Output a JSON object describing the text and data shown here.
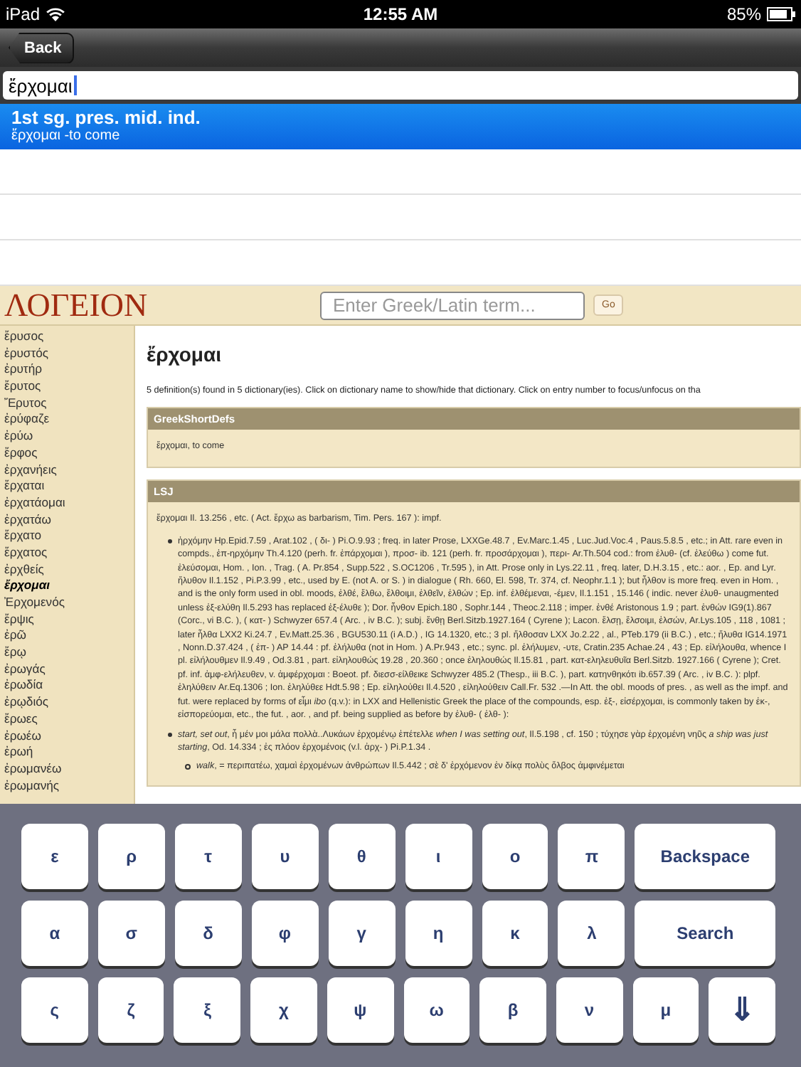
{
  "status_bar": {
    "device": "iPad",
    "time": "12:55 AM",
    "battery": "85%"
  },
  "nav_bar": {
    "back": "Back"
  },
  "search": {
    "value": "ἔρχομαι"
  },
  "results": [
    {
      "title": "1st sg. pres. mid. ind.",
      "subtitle": "ἔρχομαι  -to come",
      "selected": true
    }
  ],
  "logeion": {
    "logo": "ΛΟΓΕΙΟΝ",
    "search": {
      "placeholder": "Enter Greek/Latin term..."
    },
    "go": "Go",
    "word_list": [
      {
        "label": "ἔρυσος",
        "selected": false
      },
      {
        "label": "ἐρυστός",
        "selected": false
      },
      {
        "label": "ἐρυτήρ",
        "selected": false
      },
      {
        "label": "ἔρυτος",
        "selected": false
      },
      {
        "label": "Ἔρυτος",
        "selected": false
      },
      {
        "label": "ἐρύφαζε",
        "selected": false
      },
      {
        "label": "ἐρύω",
        "selected": false
      },
      {
        "label": "ἔρφος",
        "selected": false
      },
      {
        "label": "ἐρχανήεις",
        "selected": false
      },
      {
        "label": "ἔρχαται",
        "selected": false
      },
      {
        "label": "ἐρχατάομαι",
        "selected": false
      },
      {
        "label": "ἐρχατάω",
        "selected": false
      },
      {
        "label": "ἔρχατο",
        "selected": false
      },
      {
        "label": "ἔρχατος",
        "selected": false
      },
      {
        "label": "ἐρχθείς",
        "selected": false
      },
      {
        "label": "ἔρχομαι",
        "selected": true
      },
      {
        "label": "Ἐρχομενός",
        "selected": false
      },
      {
        "label": "ἔρψις",
        "selected": false
      },
      {
        "label": "ἐρῶ",
        "selected": false
      },
      {
        "label": "ἔρῳ",
        "selected": false
      },
      {
        "label": "ἐρωγάς",
        "selected": false
      },
      {
        "label": "ἐρωδία",
        "selected": false
      },
      {
        "label": "ἐρῳδιός",
        "selected": false
      },
      {
        "label": "ἔρωες",
        "selected": false
      },
      {
        "label": "ἐρωέω",
        "selected": false
      },
      {
        "label": "ἐρωή",
        "selected": false
      },
      {
        "label": "ἐρωμανέω",
        "selected": false
      },
      {
        "label": "ἐρωμανής",
        "selected": false
      }
    ],
    "headword": "ἔρχομαι",
    "summary": "5 definition(s) found in 5 dictionary(ies). Click on dictionary name to show/hide that dictionary. Click on entry number to focus/unfocus on tha",
    "dictionaries": [
      {
        "name": "GreekShortDefs",
        "blocks": [
          {
            "kind": "para",
            "text": "ἔρχομαι, to come"
          }
        ]
      },
      {
        "name": "LSJ",
        "blocks": [
          {
            "kind": "para",
            "text": "ἔρχομαι Il. 13.256 , etc. ( Act. ἔρχω as barbarism, Tim. Pers. 167 ): impf."
          },
          {
            "kind": "bullet",
            "text": "ἠρχόμην Hp.Epid.7.59 , Arat.102 , ( δι- ) Pi.O.9.93 ; freq. in later Prose, LXXGe.48.7 , Ev.Marc.1.45 , Luc.Jud.Voc.4 , Paus.5.8.5 , etc.; in Att. rare even in compds., ἐπ-ηρχόμην Th.4.120 (perh. fr. ἐπάρχομαι ), προσ- ib. 121 (perh. fr. προσάρχομαι ), περι- Ar.Th.504 cod.: from ἐλυθ- (cf. ἐλεύθω ) come fut. ἐλεύσομαι, Hom. , Ion. , Trag. ( A. Pr.854 , Supp.522 , S.OC1206 , Tr.595 ), in Att. Prose only in Lys.22.11 , freq. later, D.H.3.15 , etc.: aor. , Ep. and Lyr. ἤλυθον Il.1.152 , Pi.P.3.99 , etc., used by E. (not A. or S. ) in dialogue ( Rh. 660, El. 598, Tr. 374, cf. Neophr.1.1 ); but ἦλθον is more freq. even in Hom. , and is the only form used in obl. moods, ἐλθέ, ἔλθω, ἔλθοιμι, ἐλθεῖν, ἐλθών ; Ep. inf. ἐλθέμεναι, -έμεν, Il.1.151 , 15.146 ( indic. never ἐλυθ- unaugmented unless ἐξ-ελύθη Il.5.293 has replaced ἐξ-έλυθε ); Dor. ἦνθον Epich.180 , Sophr.144 , Theoc.2.118 ; imper. ἐνθέ Aristonous 1.9 ; part. ἐνθών IG9(1).867 (Corc., vi B.C. ), ( κατ- ) Schwyzer 657.4 ( Arc. , iv B.C. ); subj. ἔνθῃ Berl.Sitzb.1927.164 ( Cyrene ); Lacon. ἔλσῃ, ἔλσοιμι, ἐλσών, Ar.Lys.105 , 118 , 1081 ; later ἦλθα LXX2 Ki.24.7 , Ev.Matt.25.36 , BGU530.11 (i A.D.) , IG 14.1320, etc.; 3 pl. ἤλθοσαν LXX Jo.2.22 , al., PTeb.179 (ii B.C.) , etc.; ἤλυθα IG14.1971 , Nonn.D.37.424 , ( ἐπ- ) AP 14.44 : pf. ἐλήλυθα (not in Hom. ) A.Pr.943 , etc.; sync. pl. ἐλήλυμεν, -υτε, Cratin.235 Achae.24 , 43 ; Ep. εἰλήλουθα, whence I pl. εἰλήλουθμεν Il.9.49 , Od.3.81 , part. εἰληλουθώς 19.28 , 20.360 ; once ἐληλουθώς Il.15.81 , part. κατ-εληλευθυῖα Berl.Sitzb. 1927.166 ( Cyrene ); Cret. pf. inf. ἀμφ-ελήλευθεν, v. ἀμφέρχομαι : Boeot. pf. διεσσ-είλθεικε Schwyzer 485.2 (Thesp., iii B.C. ), part. κατηνθηκότι ib.657.39 ( Arc. , iv B.C. ): plpf. ἐληλύθειν Ar.Eq.1306 ; Ion. ἐληλύθεε Hdt.5.98 ; Ep. εἰληλούθει Il.4.520 , εἰληλούθειν Call.Fr. 532 .—In Att. the obl. moods of pres. , as well as the impf. and fut. were replaced by forms of εἶμι *ibo* (q.v.): in LXX and Hellenistic Greek the place of the compounds, esp. ἐξ-, εἰσέρχομαι, is commonly taken by ἐκ-, εἰσπορεύομαι, etc., the fut. , aor. , and pf. being supplied as before by ἐλυθ- ( ἐλθ- ):"
          },
          {
            "kind": "bullet",
            "text": "*start, set out*, ἦ μέν μοι μάλα πολλὰ..Λυκάων ἐρχομένῳ ἐπέτελλε *when I was setting out*, Il.5.198 , cf. 150 ; τύχησε γὰρ ἐρχομένη νηῦς *a ship was just starting*, Od. 14.334 ; ἐς πλόον ἐρχομένοις (v.l. ἀρχ- ) Pi.P.1.34 ."
          },
          {
            "kind": "subbullet",
            "text": "*walk*, = περιπατέω, χαμαὶ ἐρχομένων ἀνθρώπων Il.5.442 ; σὲ δ' ἐρχόμενον ἐν δίκᾳ πολὺς ὄλβος ἀμφινέμεται"
          }
        ]
      }
    ]
  },
  "keyboard": [
    [
      {
        "label": "ε",
        "kind": "letter"
      },
      {
        "label": "ρ",
        "kind": "letter"
      },
      {
        "label": "τ",
        "kind": "letter"
      },
      {
        "label": "υ",
        "kind": "letter"
      },
      {
        "label": "θ",
        "kind": "letter"
      },
      {
        "label": "ι",
        "kind": "letter"
      },
      {
        "label": "ο",
        "kind": "letter"
      },
      {
        "label": "π",
        "kind": "letter"
      },
      {
        "label": "Backspace",
        "kind": "wide"
      }
    ],
    [
      {
        "label": "α",
        "kind": "letter"
      },
      {
        "label": "σ",
        "kind": "letter"
      },
      {
        "label": "δ",
        "kind": "letter"
      },
      {
        "label": "φ",
        "kind": "letter"
      },
      {
        "label": "γ",
        "kind": "letter"
      },
      {
        "label": "η",
        "kind": "letter"
      },
      {
        "label": "κ",
        "kind": "letter"
      },
      {
        "label": "λ",
        "kind": "letter"
      },
      {
        "label": "Search",
        "kind": "wide"
      }
    ],
    [
      {
        "label": "ς",
        "kind": "letter"
      },
      {
        "label": "ζ",
        "kind": "letter"
      },
      {
        "label": "ξ",
        "kind": "letter"
      },
      {
        "label": "χ",
        "kind": "letter"
      },
      {
        "label": "ψ",
        "kind": "letter"
      },
      {
        "label": "ω",
        "kind": "letter"
      },
      {
        "label": "β",
        "kind": "letter"
      },
      {
        "label": "ν",
        "kind": "letter"
      },
      {
        "label": "μ",
        "kind": "letter"
      },
      {
        "label": "⇓",
        "kind": "symbol"
      }
    ]
  ]
}
